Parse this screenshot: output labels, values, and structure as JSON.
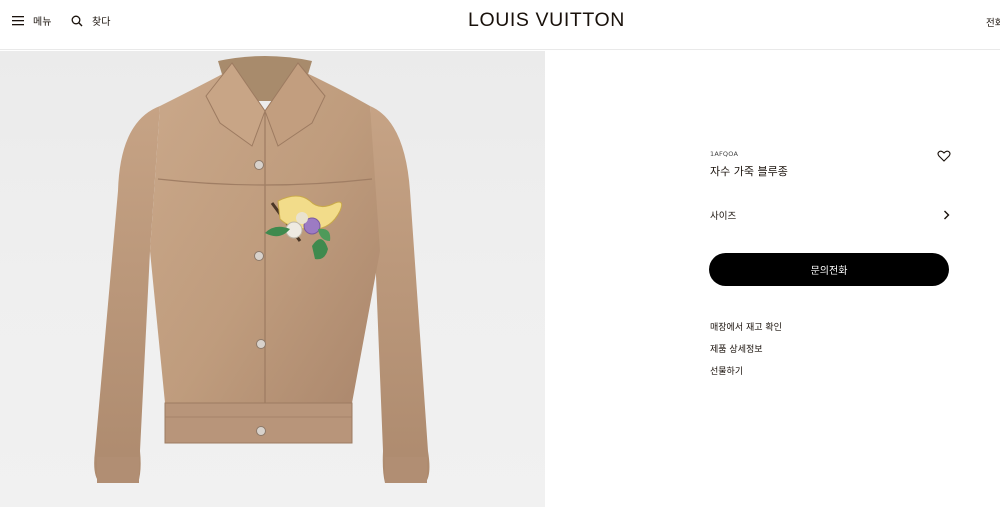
{
  "header": {
    "menu_label": "메뉴",
    "search_label": "찾다",
    "brand": "LOUIS VUITTON",
    "call_label": "전화"
  },
  "product": {
    "sku": "1AFQOA",
    "name": "자수 가죽 블루종",
    "size_label": "사이즈",
    "cta_label": "문의전화",
    "links": [
      "매장에서 재고 확인",
      "제품 상세정보",
      "선물하기"
    ]
  },
  "icons": {
    "menu": "hamburger-icon",
    "search": "search-icon",
    "wishlist": "heart-icon",
    "size": "chevron-right-icon"
  },
  "colors": {
    "text": "#19110b",
    "cta_background": "#000000",
    "cta_text": "#ffffff",
    "leather": "#c29f80"
  }
}
